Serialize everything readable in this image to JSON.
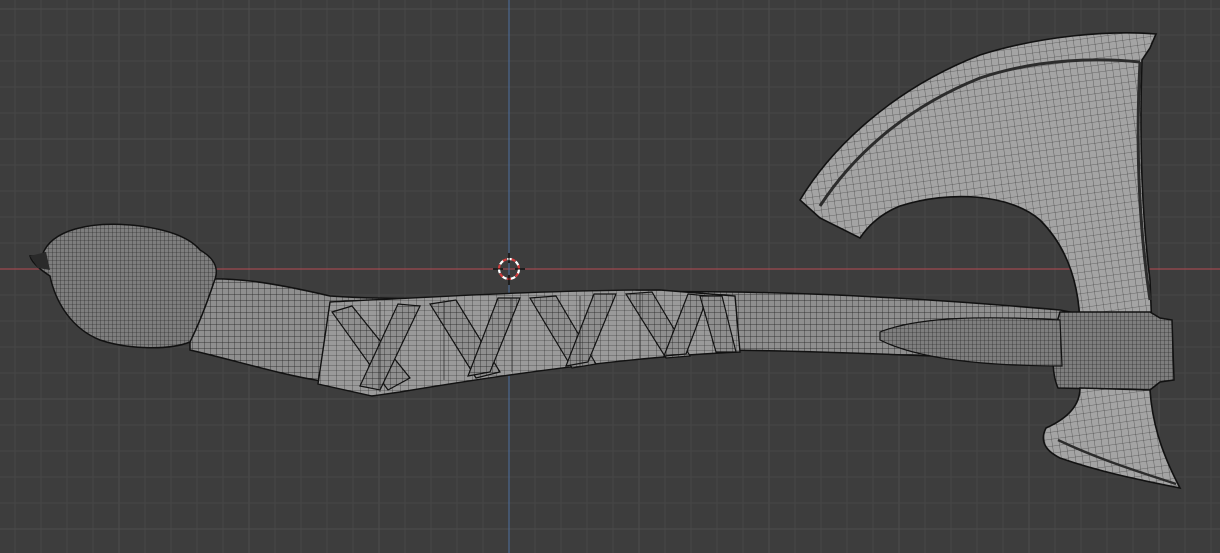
{
  "viewport": {
    "background": "#3d3d3d",
    "grid_minor_color": "#464646",
    "grid_major_color": "#4d4d4d",
    "x_axis_color": "#b54a53",
    "y_axis_color": "#4d6fa0",
    "cursor_colors": [
      "#ffffff",
      "#d43d3d"
    ],
    "mesh_fill": "#8c8c8c",
    "mesh_fill_light": "#a9a9a9",
    "mesh_wire": "#1e1e1e"
  },
  "object": {
    "parts": [
      {
        "name": "pommel-knob"
      },
      {
        "name": "handle"
      },
      {
        "name": "leather-wrap"
      },
      {
        "name": "axe-head-upper-blade"
      },
      {
        "name": "axe-head-lower-beard"
      },
      {
        "name": "axe-eye-socket"
      }
    ]
  },
  "widgets": [
    {
      "name": "3d-cursor-icon"
    }
  ]
}
